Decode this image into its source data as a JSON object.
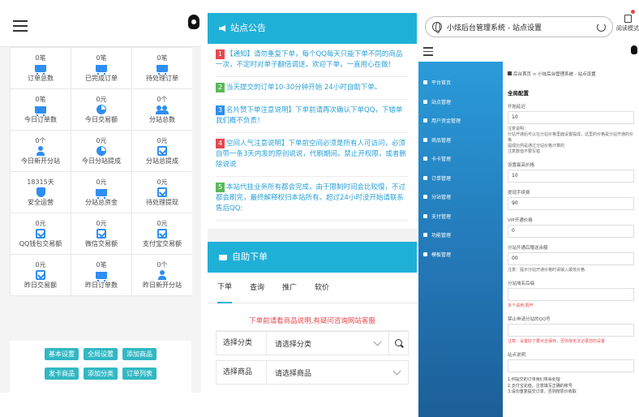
{
  "stats_panel": {
    "items": [
      {
        "value": "0笔",
        "icon": "cart-icon",
        "label": "订单总数"
      },
      {
        "value": "0笔",
        "icon": "cart-icon",
        "label": "已完成订单"
      },
      {
        "value": "0笔",
        "icon": "cart-icon",
        "label": "待处理订单"
      },
      {
        "value": "0笔",
        "icon": "cart-icon",
        "label": "今日订单数"
      },
      {
        "value": "0元",
        "icon": "pie-chart-icon",
        "label": "今日交易额"
      },
      {
        "value": "0个",
        "icon": "users-icon",
        "label": "分站总数"
      },
      {
        "value": "0个",
        "icon": "user-icon",
        "label": "今日新开分站"
      },
      {
        "value": "0元",
        "icon": "pie-chart-icon",
        "label": "今日分站提成"
      },
      {
        "value": "0元",
        "icon": "checkbox-icon",
        "label": "分站总提成"
      },
      {
        "value": "18315天",
        "icon": "shield-icon",
        "label": "安全运营"
      },
      {
        "value": "0元",
        "icon": "cart-icon",
        "label": "分站总资金"
      },
      {
        "value": "0元",
        "icon": "checkbox-icon",
        "label": "待处理提现"
      },
      {
        "value": "0元",
        "icon": "checkbox-icon",
        "label": "QQ钱包交易额"
      },
      {
        "value": "0元",
        "icon": "checkbox-icon",
        "label": "微信交易额"
      },
      {
        "value": "0元",
        "icon": "checkbox-icon",
        "label": "支付宝交易额"
      },
      {
        "value": "0元",
        "icon": "checkbox-icon",
        "label": "昨日交易额"
      },
      {
        "value": "0笔",
        "icon": "cart-icon",
        "label": "昨日订单数"
      },
      {
        "value": "0个",
        "icon": "user-icon",
        "label": "昨日新开分站"
      }
    ],
    "buttons_row1": [
      "基本设置",
      "全局设置",
      "添加商品"
    ],
    "buttons_row2": [
      "发卡商品",
      "添加分类",
      "订单列表"
    ]
  },
  "announcement": {
    "title": "站点公告",
    "items": [
      {
        "num": "1",
        "num_color": "#e5484d",
        "text": "【通知】请勿重复下单，每个QQ每天只能下单不同的商品一次，不定时对单子翻倍调送，欢迎下单，一直用心在做！"
      },
      {
        "num": "2",
        "num_color": "#5cb85c",
        "text": "当天提交的订单10-30分钟开始 24小时自助下单。"
      },
      {
        "num": "3",
        "num_color": "#2f8ef2",
        "text": "名片赞下单注意说明】下单前请再次确认下单QQ，下错单我们概不负责！"
      },
      {
        "num": "4",
        "num_color": "#e5484d",
        "text": "空间人气注意说明】下单前空间必须是所有人可访问，必须自带一条3天内发的原创说说，代刷期间，禁止开权限，或者删除说说"
      },
      {
        "num": "5",
        "num_color": "#5cb85c",
        "text": "本站代挂业务所有都会完成，由于限制时间会比较慢，不过都会刷完，最终解释权归本站所有。超过24小时没开始请联系售后QQ:"
      }
    ]
  },
  "auto_order": {
    "title": "自助下单",
    "tabs": [
      "下单",
      "查询",
      "推广",
      "软价"
    ],
    "notice": "下单前请看商品说明,有疑问咨询网站客服",
    "category_label": "选择分类",
    "category_value": "请选择分类",
    "goods_label": "选择商品",
    "goods_value": "请选择商品"
  },
  "admin": {
    "address_bar": "小炫后台管理系统 - 站点设置",
    "reader_mode": "阅读模式",
    "sidebar": [
      "平台首页",
      "站点管理",
      "用户资金管理",
      "商品管理",
      "卡卡管理",
      "订单管理",
      "分站管理",
      "支付管理",
      "功能管理",
      "模板管理"
    ],
    "breadcrumb": "后台首页 > 小炫后台管理系统 - 站点设置",
    "section_title": "全局配置",
    "fields": [
      {
        "label": "开始延迟",
        "value": "10"
      },
      {
        "label": "设置最高价格",
        "value": "10"
      },
      {
        "label": "提现手续费",
        "value": "90"
      },
      {
        "label": "VIP开通价格",
        "value": "0"
      },
      {
        "label": "分站开通后赠送余额",
        "value": "00"
      }
    ],
    "help_text": "注意说明：\n分站开通后可以在分站价格里面设置提成，这里的价格是分站开通的价格\n提成比例是通过分站价格计算的\n注意数值不要写错",
    "tail_help": "注意：提示分站开通价格时请输入最低价格",
    "label_site_title": "分站域名后缀",
    "red_help_a": "多个请用,隔开",
    "label_banlist": "禁止申请分站的QQ号",
    "red_help_b": "注意：设置好了要点击保存，否则将无法记录您的设置",
    "label_qa": "站点说明",
    "list_lines": [
      "1.你提交的订单我们将会处理",
      "2.支付宝充值，注意填写正确的账号",
      "3.请勿重复提交订单，否则按原价收取"
    ]
  }
}
